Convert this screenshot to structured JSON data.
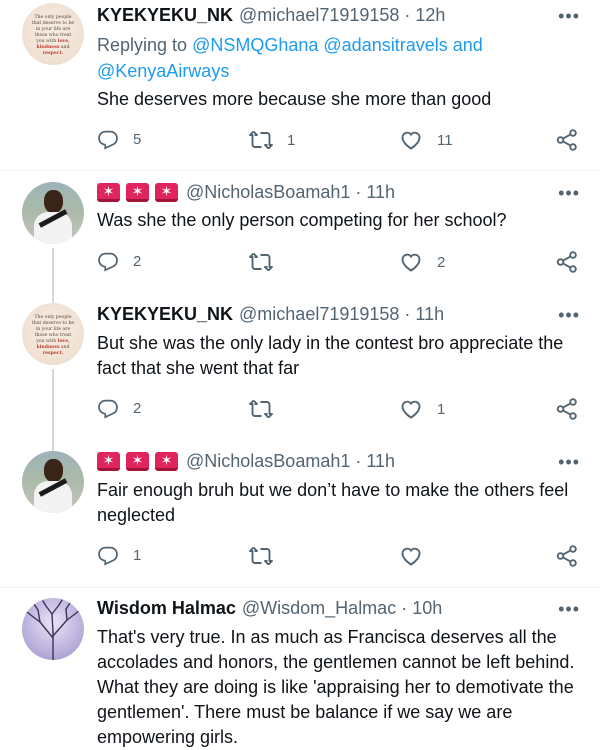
{
  "tweets": [
    {
      "name": "KYEKYEKU_NK",
      "handle": "@michael71919158 · 12h",
      "reply_prefix": "Replying to",
      "reply_to": "@NSMQGhana @adansitravels",
      "reply_and": "and",
      "reply_to2": "@KenyaAirways",
      "text": "She deserves more because she more than good",
      "replies": "5",
      "retweets": "1",
      "likes": "11",
      "avatar_text_1": "The only people that deserve to be in your life are those who treat you with",
      "avatar_text_2": "love, kindness",
      "avatar_text_3": "and",
      "avatar_text_4": "respect."
    },
    {
      "name": "",
      "handle": "@NicholasBoamah1 · 11h",
      "text": "Was she the only person competing for her school?",
      "replies": "2",
      "retweets": "",
      "likes": "2"
    },
    {
      "name": "KYEKYEKU_NK",
      "handle": "@michael71919158 · 11h",
      "text": "But she was the only lady in the contest bro appreciate the fact that she went that far",
      "replies": "2",
      "retweets": "",
      "likes": "1",
      "avatar_text_1": "The only people that deserve to be in your life are those who treat you with",
      "avatar_text_2": "love, kindness",
      "avatar_text_3": "and",
      "avatar_text_4": "respect."
    },
    {
      "name": "",
      "handle": "@NicholasBoamah1 · 11h",
      "text": "Fair enough bruh but we don’t have to make the others feel neglected",
      "replies": "1",
      "retweets": "",
      "likes": ""
    },
    {
      "name": "Wisdom Halmac",
      "handle": "@Wisdom_Halmac · 10h",
      "text": "That's very true. In as much as Francisca deserves all the accolades and honors, the gentlemen cannot be left behind. What they are doing is like 'appraising her to demotivate the gentlemen'. There must be balance if we say we are empowering girls."
    }
  ],
  "icons": {
    "more": "more-icon",
    "reply": "reply-icon",
    "retweet": "retweet-icon",
    "like": "heart-icon",
    "share": "share-icon",
    "siren": "police-light-emoji"
  },
  "colors": {
    "link": "#1d9bf0",
    "secondary_text": "#536471",
    "thread_line": "#cfd9de",
    "siren": "#e0245e"
  }
}
